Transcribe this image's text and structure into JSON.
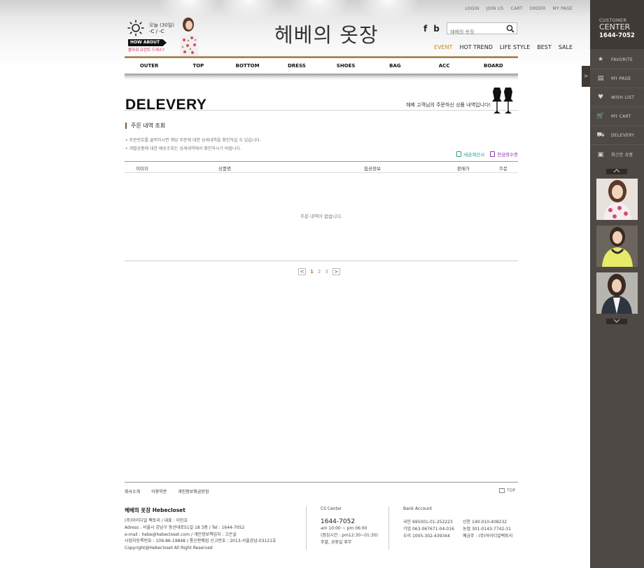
{
  "top_links": [
    "LOGIN",
    "JOIN US",
    "CART",
    "ORDER",
    "MY PAGE"
  ],
  "weather": {
    "day": "오늘 (30일)",
    "temp": "-C / -C"
  },
  "promo": {
    "badge": "HOW ABOUT",
    "text": "플라워 프린트 드레스?"
  },
  "logo": "헤베의 옷장",
  "social": {
    "facebook": "f",
    "blog": "b"
  },
  "search": {
    "placeholder": "헤베의 옷장"
  },
  "categories": [
    "EVENT",
    "HOT TREND",
    "LIFE STYLE",
    "BEST",
    "SALE"
  ],
  "gnb": [
    "OUTER",
    "TOP",
    "BOTTOM",
    "DRESS",
    "SHOES",
    "BAG",
    "ACC",
    "BOARD"
  ],
  "page": {
    "title": "DELEVERY",
    "desc": "헤베 고객님의 주문하신 상품 내역입니다!",
    "section_title": "주문 내역 조회",
    "notes": [
      "• 주문번호를 클릭하시면 해당 주문에 대한 상세내역을 확인하실 수 있습니다.",
      "• 개별상품에 대한 배송조회는 상세내역에서 확인하시기 바랍니다."
    ],
    "tax_invoice": "세금계산서",
    "cash_receipt": "현금영수증",
    "columns": [
      "이미지",
      "상품명",
      "옵션정보",
      "판매가",
      "주문"
    ],
    "empty_message": "주문 내역이 없습니다.",
    "pages": [
      "1",
      "2",
      "3"
    ],
    "prev": "<",
    "next": ">"
  },
  "footer": {
    "links": [
      "회사소개",
      "이용약관",
      "개인정보취급방침"
    ],
    "top_label": "TOP",
    "company_name": "헤베의 옷장 Hebecloset",
    "company_lines": [
      "(주)아이디얼 팩토리  /  대표 : 이민호",
      "Adress : 서울시 강남구 동산대로51길 18 3층 /  Tel : 1644-7052",
      "e-mail : hebe@hebecloset.com  /  개인정보책임자 : 고은실",
      "사업자등록번호 : 109-86-19848   /   통신판매업 신고번호 : 2013-서울강남-03121호",
      "Copyright@Hebecloset All Right Reserved"
    ],
    "cs_title": "CS Center",
    "cs_tel": "1644-7052",
    "cs_lines": [
      "am 10:00 ~ pm 06:00",
      "(점심시간 : pm12:30~01:30)",
      "주말, 공휴일 휴무"
    ],
    "bank_title": "Bank Account",
    "bank_col1": [
      "국민 695001-01-252223",
      "기업 063-067671-04-016",
      "우리 1005-302-439344"
    ],
    "bank_col2": [
      "신한 140-010-408232",
      "농협 301-0143-7742-31",
      "예금주 : (주)아이디얼팩토리"
    ]
  },
  "sidebar": {
    "cc_line1": "CUSTOMER",
    "cc_line2": "CENTER",
    "cc_tel": "1644-7052",
    "menu": [
      {
        "icon": "★",
        "label": "FAVORITE"
      },
      {
        "icon": "▤",
        "label": "MY PAGE"
      },
      {
        "icon": "♥",
        "label": "WISH LIST"
      },
      {
        "icon": "🛒",
        "label": "MY CART"
      },
      {
        "icon": "⛟",
        "label": "DELEVERY"
      },
      {
        "icon": "▣",
        "label": "최근본 상품"
      }
    ],
    "toggle": ">"
  },
  "colors": {
    "accent": "#c2762a",
    "sidebar_bg": "#4e4944",
    "gnb_gold": "#b79a6b"
  }
}
